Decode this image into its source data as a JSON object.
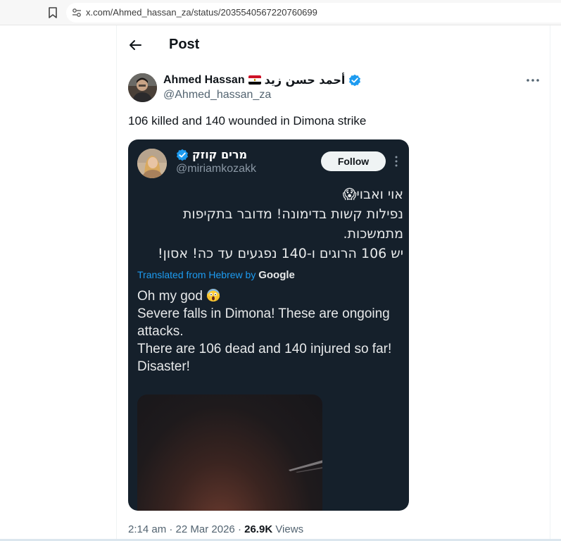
{
  "browser": {
    "url": "x.com/Ahmed_hassan_za/status/2035540567220760699"
  },
  "header": {
    "title": "Post"
  },
  "author": {
    "name": "Ahmed Hassan",
    "name_arabic": "أحمد حسن زيد",
    "handle": "@Ahmed_hassan_za",
    "flag_icon": "egypt-flag-icon",
    "verified_icon": "verified-badge-icon"
  },
  "tweet": {
    "text": "106 killed and 140 wounded in Dimona strike"
  },
  "quoted": {
    "name": "מרים קוזק",
    "handle": "@miriamkozakk",
    "follow_label": "Follow",
    "hebrew_lines": [
      "אוי ואבוי😱",
      "נפילות קשות בדימונה! מדובר בתקיפות",
      "מתמשכות.",
      "יש 106 הרוגים ו-140 נפגעים עד כה! אסון!"
    ],
    "translated_label": "Translated from Hebrew by",
    "translated_by": "Google",
    "english_lines": [
      "Oh my god",
      "Severe falls in Dimona! These are ongoing attacks.",
      "There are 106 dead and 140 injured so far! Disaster!"
    ],
    "emoji_icon": "screaming-face-emoji-icon"
  },
  "meta": {
    "time": "2:14 am",
    "date": "22 Mar 2026",
    "separator": "·",
    "views_count": "26.9K",
    "views_label": "Views"
  },
  "colors": {
    "verified_blue": "#1d9bf0",
    "card_bg": "#15202b",
    "secondary_text": "#536471"
  }
}
